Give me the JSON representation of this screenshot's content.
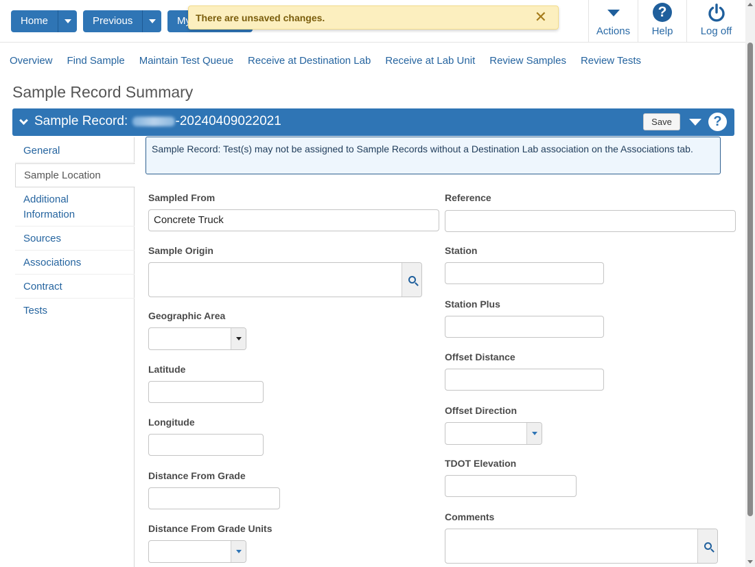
{
  "toolbar": {
    "home_label": "Home",
    "previous_label": "Previous",
    "my_label": "My",
    "actions_label": "Actions",
    "help_label": "Help",
    "logoff_label": "Log off"
  },
  "toast": {
    "message": "There are unsaved changes.",
    "close_glyph": "✕"
  },
  "nav": {
    "links": [
      "Overview",
      "Find Sample",
      "Maintain Test Queue",
      "Receive at Destination Lab",
      "Receive at Lab Unit",
      "Review Samples",
      "Review Tests"
    ]
  },
  "page": {
    "title": "Sample Record Summary"
  },
  "record": {
    "prefix": "Sample Record:",
    "id_suffix": "-20240409022021",
    "save_label": "Save"
  },
  "tabs": {
    "items": [
      "General",
      "Sample Location",
      "Additional Information",
      "Sources",
      "Associations",
      "Contract",
      "Tests"
    ],
    "active": "Sample Location"
  },
  "info": {
    "message": "Sample Record: Test(s) may not be assigned to Sample Records without a Destination Lab association on the Associations tab."
  },
  "form": {
    "sampled_from": {
      "label": "Sampled From",
      "value": "Concrete Truck"
    },
    "sample_origin": {
      "label": "Sample Origin",
      "value": ""
    },
    "geographic_area": {
      "label": "Geographic Area",
      "value": ""
    },
    "latitude": {
      "label": "Latitude",
      "value": ""
    },
    "longitude": {
      "label": "Longitude",
      "value": ""
    },
    "distance_from_grade": {
      "label": "Distance From Grade",
      "value": ""
    },
    "distance_from_grade_units": {
      "label": "Distance From Grade Units",
      "value": ""
    },
    "reference": {
      "label": "Reference",
      "value": ""
    },
    "station": {
      "label": "Station",
      "value": ""
    },
    "station_plus": {
      "label": "Station Plus",
      "value": ""
    },
    "offset_distance": {
      "label": "Offset Distance",
      "value": ""
    },
    "offset_direction": {
      "label": "Offset Direction",
      "value": ""
    },
    "tdot_elevation": {
      "label": "TDOT Elevation",
      "value": ""
    },
    "comments": {
      "label": "Comments",
      "value": ""
    }
  },
  "colors": {
    "primary": "#2f75b5",
    "toast_bg": "#fcefbf",
    "link": "#25649f"
  }
}
